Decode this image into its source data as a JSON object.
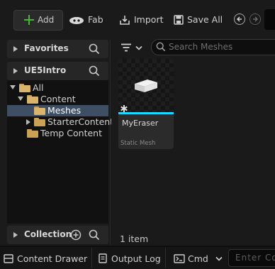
{
  "toolbar": {
    "add_label": "Add",
    "fab_label": "Fab",
    "import_label": "Import",
    "save_all_label": "Save All"
  },
  "sidebar": {
    "favorites_label": "Favorites",
    "project_label": "UE5Intro",
    "collection_label": "Collection",
    "tree": [
      {
        "label": "All",
        "expanded": true,
        "selected": false
      },
      {
        "label": "Content",
        "expanded": true,
        "selected": false
      },
      {
        "label": "Meshes",
        "expanded": false,
        "selected": true
      },
      {
        "label": "StarterContent",
        "expanded": false,
        "selected": false
      },
      {
        "label": "Temp Content",
        "expanded": false,
        "selected": false
      }
    ]
  },
  "content": {
    "search_placeholder": "Search Meshes",
    "asset": {
      "name": "MyEraser",
      "type": "Static Mesh"
    },
    "item_count": "1 item"
  },
  "bottombar": {
    "content_drawer_label": "Content Drawer",
    "output_log_label": "Output Log",
    "cmd_label": "Cmd",
    "console_placeholder": "Enter Co"
  },
  "colors": {
    "accent": "#1ed6ff",
    "selection": "#3e4f64",
    "folder": "#c9a256",
    "add_plus": "#4bb53a"
  }
}
